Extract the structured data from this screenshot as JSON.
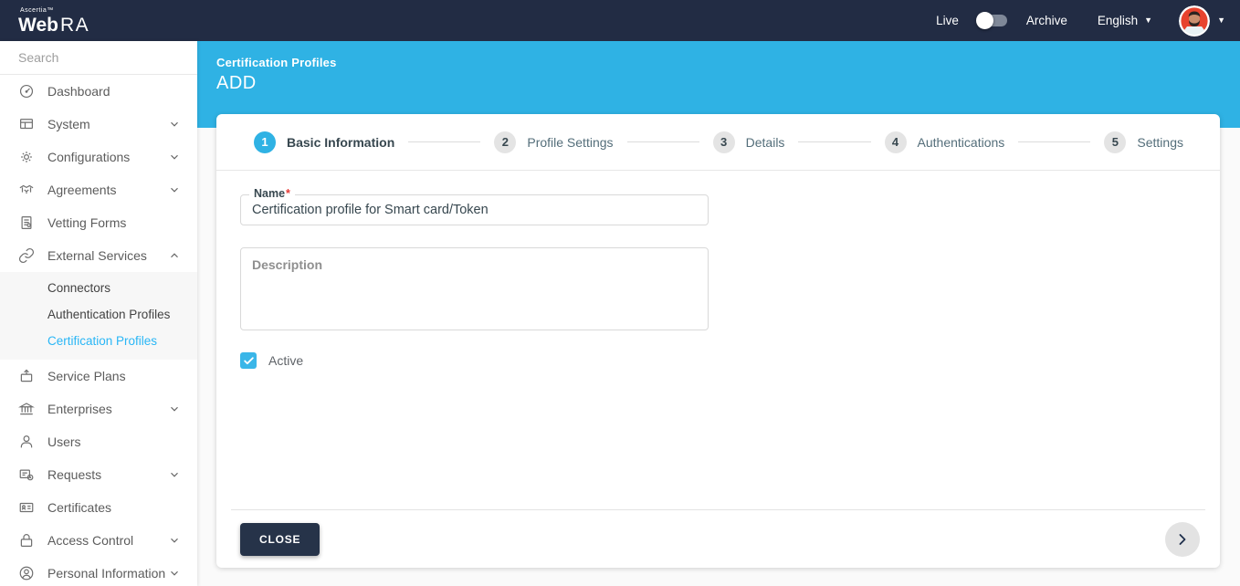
{
  "topbar": {
    "brand": {
      "company": "Ascertia™",
      "product_web": "Web",
      "product_ra": "RA"
    },
    "mode_toggle": {
      "left_label": "Live",
      "right_label": "Archive",
      "state": "live"
    },
    "language": {
      "selected": "English"
    }
  },
  "sidebar": {
    "search": {
      "placeholder": "Search"
    },
    "items": [
      {
        "label": "Dashboard",
        "icon": "dashboard-icon",
        "chevron": null
      },
      {
        "label": "System",
        "icon": "system-icon",
        "chevron": "down"
      },
      {
        "label": "Configurations",
        "icon": "configurations-icon",
        "chevron": "down"
      },
      {
        "label": "Agreements",
        "icon": "agreements-icon",
        "chevron": "down"
      },
      {
        "label": "Vetting Forms",
        "icon": "vetting-forms-icon",
        "chevron": null
      },
      {
        "label": "External Services",
        "icon": "external-services-icon",
        "chevron": "up",
        "expanded": true
      },
      {
        "label": "Service Plans",
        "icon": "service-plans-icon",
        "chevron": null
      },
      {
        "label": "Enterprises",
        "icon": "enterprises-icon",
        "chevron": "down"
      },
      {
        "label": "Users",
        "icon": "users-icon",
        "chevron": null
      },
      {
        "label": "Requests",
        "icon": "requests-icon",
        "chevron": "down"
      },
      {
        "label": "Certificates",
        "icon": "certificates-icon",
        "chevron": null
      },
      {
        "label": "Access Control",
        "icon": "access-control-icon",
        "chevron": "down"
      },
      {
        "label": "Personal Information",
        "icon": "personal-information-icon",
        "chevron": "down"
      }
    ],
    "external_services_submenu": {
      "items": [
        {
          "label": "Connectors",
          "active": false
        },
        {
          "label": "Authentication Profiles",
          "active": false
        },
        {
          "label": "Certification Profiles",
          "active": true
        }
      ]
    }
  },
  "page_header": {
    "section": "Certification Profiles",
    "title": "ADD"
  },
  "wizard": {
    "steps": [
      {
        "number": "1",
        "label": "Basic Information",
        "active": true
      },
      {
        "number": "2",
        "label": "Profile Settings",
        "active": false
      },
      {
        "number": "3",
        "label": "Details",
        "active": false
      },
      {
        "number": "4",
        "label": "Authentications",
        "active": false
      },
      {
        "number": "5",
        "label": "Settings",
        "active": false
      }
    ]
  },
  "form": {
    "name": {
      "label": "Name",
      "required_marker": "*",
      "value": "Certification profile for Smart card/Token"
    },
    "description": {
      "placeholder": "Description",
      "value": ""
    },
    "active": {
      "label": "Active",
      "checked": true
    }
  },
  "footer": {
    "close_label": "CLOSE"
  },
  "colors": {
    "topbar_bg": "#222c44",
    "accent_blue": "#2fb2e4",
    "active_link_blue": "#29b6f6",
    "checkbox_blue": "#3ab6e8",
    "close_button_bg": "#263349",
    "required_red": "#e53935",
    "avatar_bg": "#e8432e"
  }
}
